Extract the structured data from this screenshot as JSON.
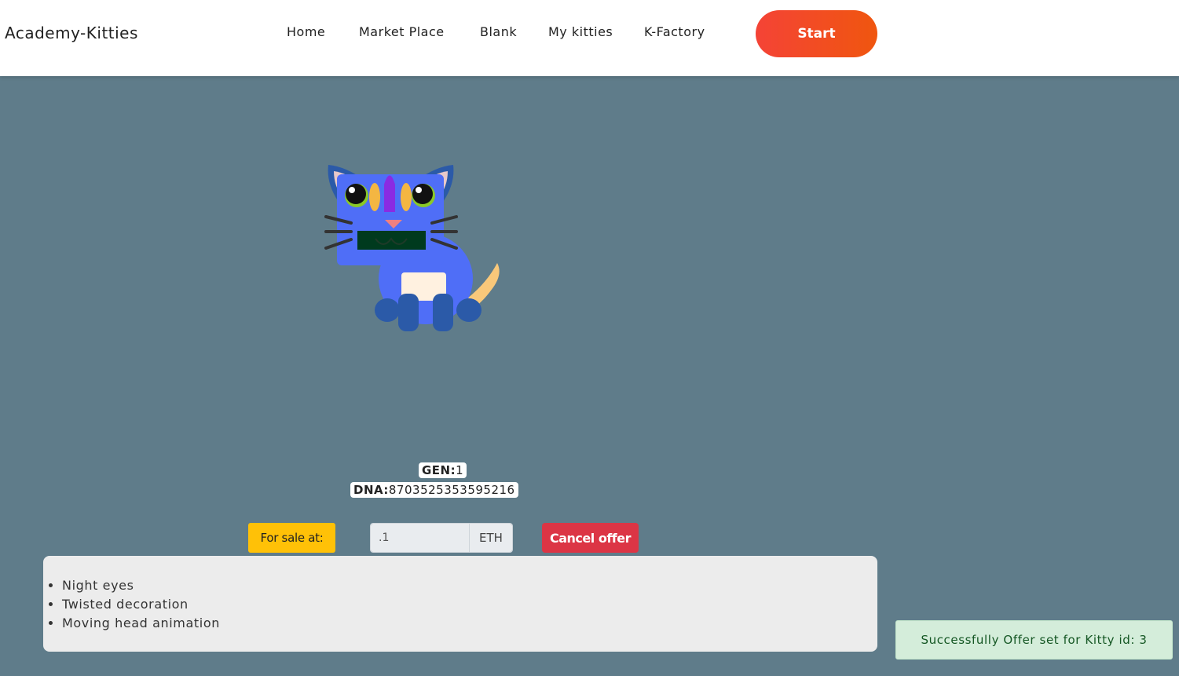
{
  "header": {
    "brand": "Academy-Kitties",
    "nav": [
      "Home",
      "Market Place",
      "Blank",
      "My kitties",
      "K-Factory"
    ],
    "start_label": "Start"
  },
  "kitty": {
    "gen_label": "GEN:",
    "gen_value": "1",
    "dna_label": "DNA:",
    "dna_value": "8703525353595216",
    "colors": {
      "head_body": "#4f6ef7",
      "ears_paws": "#2b5aa8",
      "inner_ear": "#e8c9c9",
      "eyes": "#8ac926",
      "decoration_mid": "#8a2be2",
      "decoration_sides": "#f4b642",
      "mouth": "#003a1e",
      "nose": "#f08080",
      "belly": "#fff1e0",
      "tail": "#f9c87a"
    }
  },
  "sale": {
    "label": "For sale at:",
    "price_value": ".1",
    "unit": "ETH",
    "cancel_label": "Cancel offer"
  },
  "attributes": [
    "Night eyes",
    "Twisted decoration",
    "Moving head animation"
  ],
  "toast": "Successfully Offer set for Kitty id: 3"
}
